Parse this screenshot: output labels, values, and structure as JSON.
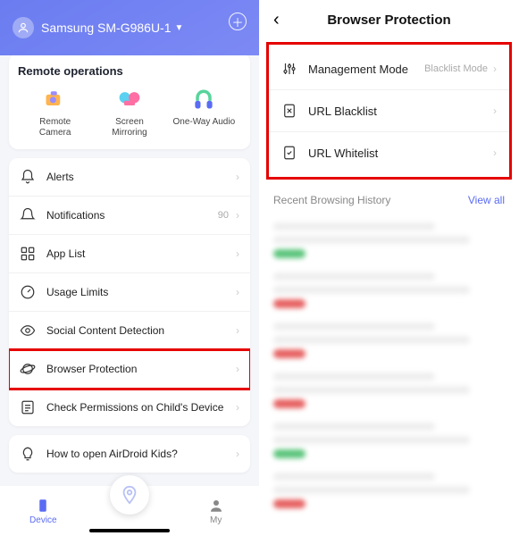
{
  "left": {
    "device_name": "Samsung SM-G986U-1",
    "remote": {
      "title": "Remote operations",
      "items": [
        {
          "label": "Remote\nCamera",
          "icon": "remote-camera-icon",
          "color1": "#ffb44d",
          "color2": "#9a8cff"
        },
        {
          "label": "Screen\nMirroring",
          "icon": "screen-mirroring-icon",
          "color1": "#5ad1f0",
          "color2": "#ff6fa3"
        },
        {
          "label": "One-Way Audio",
          "icon": "one-way-audio-icon",
          "color1": "#57d49b",
          "color2": "#5a6cf3"
        }
      ]
    },
    "list1": [
      {
        "label": "Alerts",
        "icon": "bell-icon",
        "badge": ""
      },
      {
        "label": "Notifications",
        "icon": "notification-icon",
        "badge": "90"
      },
      {
        "label": "App List",
        "icon": "grid-icon",
        "badge": ""
      },
      {
        "label": "Usage Limits",
        "icon": "gauge-icon",
        "badge": ""
      },
      {
        "label": "Social Content Detection",
        "icon": "eye-icon",
        "badge": ""
      },
      {
        "label": "Browser Protection",
        "icon": "planet-icon",
        "badge": "",
        "highlight": true
      },
      {
        "label": "Check Permissions on Child's Device",
        "icon": "checklist-icon",
        "badge": ""
      }
    ],
    "list2": [
      {
        "label": "How to open AirDroid Kids?",
        "icon": "lightbulb-icon"
      }
    ],
    "nav": {
      "device": "Device",
      "my": "My"
    }
  },
  "right": {
    "title": "Browser Protection",
    "settings": [
      {
        "label": "Management Mode",
        "value": "Blacklist Mode",
        "icon": "sliders-icon"
      },
      {
        "label": "URL Blacklist",
        "value": "",
        "icon": "blacklist-icon"
      },
      {
        "label": "URL Whitelist",
        "value": "",
        "icon": "whitelist-icon"
      }
    ],
    "history": {
      "title": "Recent Browsing History",
      "view_all": "View all"
    },
    "blur_items": [
      {
        "color": "#5ac47a"
      },
      {
        "color": "#e66060"
      },
      {
        "color": "#e66060"
      },
      {
        "color": "#e66060"
      },
      {
        "color": "#5ac47a"
      },
      {
        "color": "#e66060"
      }
    ]
  }
}
